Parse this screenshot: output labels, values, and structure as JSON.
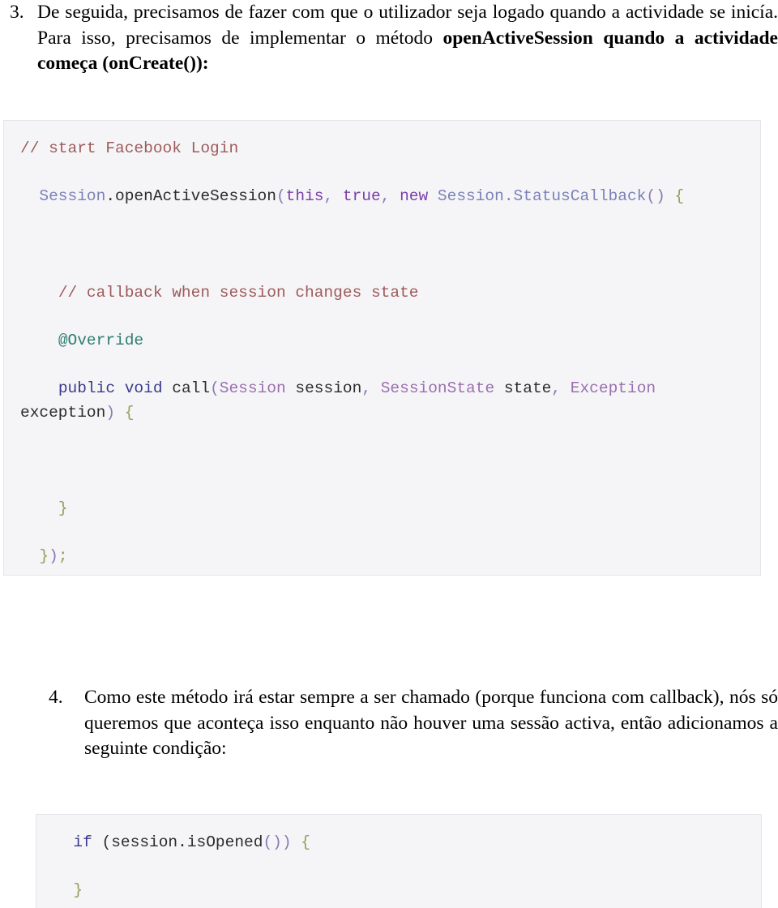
{
  "document": {
    "language": "pt-PT",
    "paragraphs": [
      {
        "number": "3.",
        "text_plain": "De seguida, precisamos de fazer com que o utilizador seja logado quando a actividade se inicía. Para isso, precisamos de implementar o método ",
        "text_bold": "openActiveSession quando a actividade começa (onCreate()):",
        "segments": {
          "lead": "De seguida, precisamos de fazer com que o utilizador seja logado quando a actividade se inicía. Para isso, precisamos de implementar o método ",
          "bold": "openActiveSession quando a actividade começa (onCreate()):"
        }
      },
      {
        "number": "4.",
        "text_plain": "Como este método irá estar sempre a ser chamado (porque funciona com callback), nós só queremos que aconteça isso enquanto não houver uma sessão activa, então adicionamos a seguinte condição:",
        "segments": {
          "lead": "Como este método irá estar sempre a ser chamado (porque funciona com callback), nós só queremos que aconteça isso enquanto não houver uma sessão activa, então adicionamos a seguinte condição:",
          "bold": ""
        }
      }
    ]
  },
  "code_blocks": [
    {
      "id": "code-block-1",
      "language": "java",
      "background": "#f5f5f7",
      "border_color": "#e2e5ea",
      "lines": [
        {
          "id": "cb1-line-1",
          "text": "// start Facebook Login",
          "tokens": [
            {
              "text": "// start Facebook Login",
              "color": "#9e5b5b",
              "class": "tok-comment"
            }
          ]
        },
        {
          "id": "cb1-line-2",
          "text": "  Session.openActiveSession(this, true, new Session.StatusCallback() {",
          "tokens": [
            {
              "text": "  ",
              "color": "#2b2b2b",
              "class": "tok-plain"
            },
            {
              "text": "Session",
              "color": "#7b81b8",
              "class": "tok-type"
            },
            {
              "text": ".openActiveSession",
              "color": "#2b2b2b",
              "class": "tok-plain"
            },
            {
              "text": "(",
              "color": "#8c78b6",
              "class": "tok-punct"
            },
            {
              "text": "this",
              "color": "#7a3fa8",
              "class": "tok-kw"
            },
            {
              "text": ", ",
              "color": "#8c78b6",
              "class": "tok-punct"
            },
            {
              "text": "true",
              "color": "#7a3fa8",
              "class": "tok-kw"
            },
            {
              "text": ", ",
              "color": "#8c78b6",
              "class": "tok-punct"
            },
            {
              "text": "new ",
              "color": "#7a3fa8",
              "class": "tok-kw"
            },
            {
              "text": "Session.StatusCallback",
              "color": "#7b81b8",
              "class": "tok-type"
            },
            {
              "text": "()",
              "color": "#8c78b6",
              "class": "tok-punct"
            },
            {
              "text": " {",
              "color": "#9a9a5c",
              "class": "tok-brace"
            }
          ]
        },
        {
          "id": "cb1-line-3",
          "text": "    // callback when session changes state",
          "tokens": [
            {
              "text": "    ",
              "color": "#2b2b2b",
              "class": "tok-plain"
            },
            {
              "text": "// callback when session changes state",
              "color": "#9e5b5b",
              "class": "tok-comment"
            }
          ]
        },
        {
          "id": "cb1-line-4",
          "text": "    @Override",
          "tokens": [
            {
              "text": "    ",
              "color": "#2b2b2b",
              "class": "tok-plain"
            },
            {
              "text": "@Override",
              "color": "#2e7d73",
              "class": "tok-anno"
            }
          ]
        },
        {
          "id": "cb1-line-5",
          "text": "    public void call(Session session, SessionState state, Exception",
          "tokens": [
            {
              "text": "    ",
              "color": "#2b2b2b",
              "class": "tok-plain"
            },
            {
              "text": "public void ",
              "color": "#3a3a8c",
              "class": "tok-kw2"
            },
            {
              "text": "call",
              "color": "#2b2b2b",
              "class": "tok-plain"
            },
            {
              "text": "(",
              "color": "#8c78b6",
              "class": "tok-punct"
            },
            {
              "text": "Session",
              "color": "#9a6fae",
              "class": "tok-purple"
            },
            {
              "text": " session",
              "color": "#2b2b2b",
              "class": "tok-plain"
            },
            {
              "text": ", ",
              "color": "#8c78b6",
              "class": "tok-punct"
            },
            {
              "text": "SessionState",
              "color": "#9a6fae",
              "class": "tok-purple"
            },
            {
              "text": " state",
              "color": "#2b2b2b",
              "class": "tok-plain"
            },
            {
              "text": ", ",
              "color": "#8c78b6",
              "class": "tok-punct"
            },
            {
              "text": "Exception",
              "color": "#9a6fae",
              "class": "tok-purple"
            }
          ]
        },
        {
          "id": "cb1-line-6",
          "text": "exception) {",
          "tokens": [
            {
              "text": "exception",
              "color": "#2b2b2b",
              "class": "tok-plain"
            },
            {
              "text": ")",
              "color": "#8c78b6",
              "class": "tok-punct"
            },
            {
              "text": " {",
              "color": "#9a9a5c",
              "class": "tok-brace"
            }
          ]
        },
        {
          "id": "cb1-line-7",
          "text": "    }",
          "tokens": [
            {
              "text": "    ",
              "color": "#2b2b2b",
              "class": "tok-plain"
            },
            {
              "text": "}",
              "color": "#9a9a5c",
              "class": "tok-brace"
            }
          ]
        },
        {
          "id": "cb1-line-8",
          "text": "  });",
          "tokens": [
            {
              "text": "  ",
              "color": "#2b2b2b",
              "class": "tok-plain"
            },
            {
              "text": "}",
              "color": "#9a9a5c",
              "class": "tok-brace"
            },
            {
              "text": ")",
              "color": "#8c78b6",
              "class": "tok-punct"
            },
            {
              "text": ";",
              "color": "#9a9a5c",
              "class": "tok-brace"
            }
          ]
        }
      ]
    },
    {
      "id": "code-block-2",
      "language": "java",
      "background": "#f5f5f7",
      "border_color": "#e2e5ea",
      "lines": [
        {
          "id": "cb2-line-1",
          "text": "  if (session.isOpened()) {",
          "tokens": [
            {
              "text": "  ",
              "color": "#2b2b2b",
              "class": "tok-plain"
            },
            {
              "text": "if",
              "color": "#3a3a8c",
              "class": "tok-kw2"
            },
            {
              "text": " (session.isOpened",
              "color": "#2b2b2b",
              "class": "tok-plain"
            },
            {
              "text": "())",
              "color": "#8c78b6",
              "class": "tok-punct"
            },
            {
              "text": " {",
              "color": "#9a9a5c",
              "class": "tok-brace"
            }
          ]
        },
        {
          "id": "cb2-line-2",
          "text": "  }",
          "tokens": [
            {
              "text": "  ",
              "color": "#2b2b2b",
              "class": "tok-plain"
            },
            {
              "text": "}",
              "color": "#9a9a5c",
              "class": "tok-brace"
            }
          ]
        }
      ]
    }
  ]
}
